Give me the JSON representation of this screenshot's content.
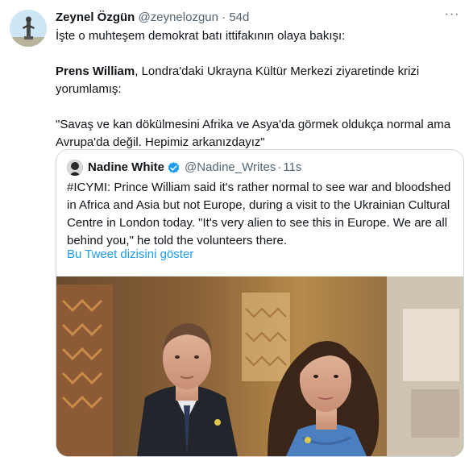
{
  "tweet": {
    "author_name": "Zeynel Özgün",
    "handle": "@zeynelozgun",
    "time": "54d",
    "more_label": "···",
    "line1": "İşte o muhteşem demokrat batı ittifakının olaya bakışı:",
    "prince_bold": "Prens William",
    "line2_rest": ", Londra'daki Ukrayna  Kültür Merkezi ziyaretinde krizi yorumlamış:",
    "quote_line": "\"Savaş ve kan dökülmesini Afrika ve Asya'da görmek oldukça normal ama Avrupa'da değil. Hepimiz arkanızdayız\""
  },
  "quoted": {
    "author_name": "Nadine White",
    "handle": "@Nadine_Writes",
    "separator": "·",
    "time": "11s",
    "text": "#ICYMI: Prince William said it's rather normal to see war and bloodshed in Africa and Asia but not Europe, during a visit to the Ukrainian Cultural Centre in London today. \"It's very alien to see this in Europe. We are all behind you,\" he told the volunteers there.",
    "thread_link": "Bu Tweet dizisini göster",
    "verified_color": "#1d9bf0"
  }
}
